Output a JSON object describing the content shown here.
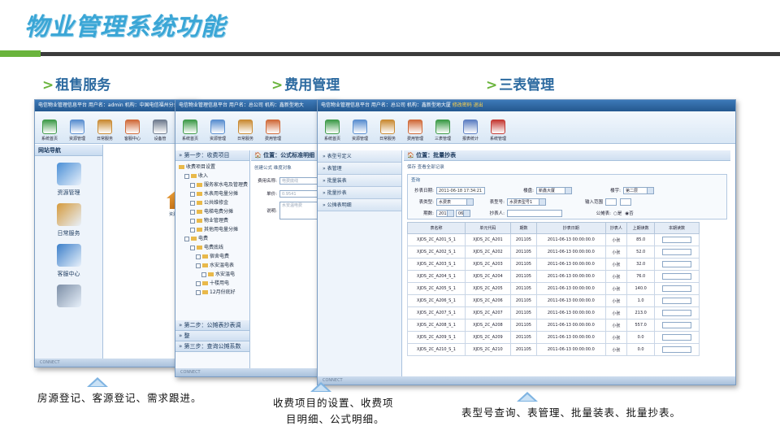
{
  "slide": {
    "title": "物业管理系统功能",
    "sections": [
      {
        "heading": "租售服务",
        "caption": "房源登记、客源登记、需求跟进。"
      },
      {
        "heading": "费用管理",
        "caption_line1": "收费项目的设置、收费项",
        "caption_line2": "目明细、公式明细。"
      },
      {
        "heading": "三表管理",
        "caption": "表型号查询、表管理、批量装表、批量抄表。"
      }
    ],
    "arrow_prefix": ">"
  },
  "screen1": {
    "topbar": "电信物业管理信息平台  用户名：admin  机构：中国电信福州分公",
    "toolbar": [
      {
        "label": "系统首页",
        "icon": "home-icon",
        "color": "#3f9b4a"
      },
      {
        "label": "资源管理",
        "icon": "resource-icon",
        "color": "#5a8fd0"
      },
      {
        "label": "日常服务",
        "icon": "service-icon",
        "color": "#c98b34"
      },
      {
        "label": "客服中心",
        "icon": "customer-icon",
        "color": "#d06a3a"
      },
      {
        "label": "设备管",
        "icon": "device-icon",
        "color": "#6f7c8f"
      }
    ],
    "nav_head": "网站导航",
    "nav_items": [
      {
        "label": "资源管理",
        "icon": "resource-folder-icon",
        "color": "#4a8fd6"
      },
      {
        "label": "日常服务",
        "icon": "daily-service-icon",
        "color": "#d59a3c"
      },
      {
        "label": "客服中心",
        "icon": "customer-center-icon",
        "color": "#3b7fc9"
      },
      {
        "label": "",
        "icon": "server-icon",
        "color": "#7c8ea6"
      }
    ],
    "side_item": "资源管理",
    "footer": "CONNECT"
  },
  "screen2": {
    "topbar": "电信物业管理信息平台  用户名：总公司  机构：鑫新型地大",
    "toolbar": [
      {
        "label": "系统首页",
        "icon": "home-icon",
        "color": "#3f9b4a"
      },
      {
        "label": "资源管理",
        "icon": "resource-icon",
        "color": "#5a8fd0"
      },
      {
        "label": "日常服务",
        "icon": "service-icon",
        "color": "#c98b34"
      },
      {
        "label": "费用管理",
        "icon": "fee-icon",
        "color": "#d06a3a"
      }
    ],
    "step1": "第一步：收费项目",
    "step2": "第二步：公摊表抄表调",
    "step2b": "整",
    "step3": "第三步：查询公摊系数",
    "tree": [
      {
        "indent": 0,
        "text": "收费项目设置"
      },
      {
        "indent": 1,
        "text": "收入"
      },
      {
        "indent": 2,
        "text": "服务家水电及管理费"
      },
      {
        "indent": 2,
        "text": "水表用电量分摊"
      },
      {
        "indent": 2,
        "text": "公共维修金"
      },
      {
        "indent": 2,
        "text": "电梯电费分摊"
      },
      {
        "indent": 2,
        "text": "物业管理费"
      },
      {
        "indent": 2,
        "text": "其他用电量分摊"
      },
      {
        "indent": 1,
        "text": "电费"
      },
      {
        "indent": 2,
        "text": "电费底线"
      },
      {
        "indent": 3,
        "text": "宿舍电费"
      },
      {
        "indent": 3,
        "text": "水安温电表"
      },
      {
        "indent": 4,
        "text": "水安温电"
      },
      {
        "indent": 3,
        "text": "十楼用电"
      },
      {
        "indent": 3,
        "text": "12月份底好"
      }
    ],
    "pos": "位置：公式标准明细",
    "subbar": "创建公式  维度对象",
    "form": [
      {
        "label": "费用名称:",
        "value": "电费底线"
      },
      {
        "label": "单价:",
        "value": "0.9541"
      },
      {
        "label": "说明:",
        "value": "水安温电费"
      }
    ],
    "footer": "CONNECT"
  },
  "screen3": {
    "topbar_prefix": "电信物业管理信息平台  用户名：总公司  机构：鑫新型地大厦",
    "topbar_highlight": "修改密码  退出",
    "toolbar": [
      {
        "label": "系统首页",
        "icon": "home-icon",
        "color": "#3f9b4a"
      },
      {
        "label": "资源管理",
        "icon": "resource-icon",
        "color": "#5a8fd0"
      },
      {
        "label": "日常服务",
        "icon": "service-icon",
        "color": "#c98b34"
      },
      {
        "label": "费用管理",
        "icon": "fee-icon",
        "color": "#d06a3a"
      },
      {
        "label": "三表管理",
        "icon": "meter-icon",
        "color": "#3c9b47"
      },
      {
        "label": "报表统计",
        "icon": "report-icon",
        "color": "#5d7fc2"
      },
      {
        "label": "系统管理",
        "icon": "system-icon",
        "color": "#c43a34"
      }
    ],
    "menu": [
      "表型号定义",
      "表管理",
      "批量装表",
      "批量抄表",
      "公摊表明细"
    ],
    "pos": "位置：批量抄表",
    "actions": "保存  查看全部记录",
    "query_tab": "查询",
    "form": {
      "reading_date_label": "抄表日期:",
      "reading_date_value": "2011-06-18 17:34:21",
      "building_label": "楼盘:",
      "building_value": "新鑫大厦",
      "floor_label": "楼宇:",
      "floor_value": "第二层",
      "meter_type_label": "表类型:",
      "meter_type_value": "水费表",
      "meter_no_label": "表型号:",
      "meter_no_value": "水费表型号1",
      "input_range_label": "输入范围",
      "period_label": "期数:",
      "period_year": "2011",
      "period_month": "06",
      "reader_label": "抄表人:",
      "shared_label": "公摊表:",
      "shared_yes": "是",
      "shared_no": "否"
    },
    "columns": [
      "表名称",
      "单元代码",
      "期数",
      "抄表日期",
      "抄表人",
      "上期读数",
      "本期读数"
    ],
    "rows": [
      [
        "XJDS_2C_A201_S_1",
        "XJDS_2C_A201",
        "201105",
        "2011-06-13 00:00:00.0",
        "小张",
        "85.0"
      ],
      [
        "XJDS_2C_A202_S_1",
        "XJDS_2C_A202",
        "201105",
        "2011-06-13 00:00:00.0",
        "小张",
        "52.0"
      ],
      [
        "XJDS_2C_A203_S_1",
        "XJDS_2C_A203",
        "201105",
        "2011-06-13 00:00:00.0",
        "小张",
        "32.0"
      ],
      [
        "XJDS_2C_A204_S_1",
        "XJDS_2C_A204",
        "201105",
        "2011-06-13 00:00:00.0",
        "小张",
        "76.0"
      ],
      [
        "XJDS_2C_A205_S_1",
        "XJDS_2C_A205",
        "201105",
        "2011-06-13 00:00:00.0",
        "小张",
        "140.0"
      ],
      [
        "XJDS_2C_A206_S_1",
        "XJDS_2C_A206",
        "201105",
        "2011-06-13 00:00:00.0",
        "小张",
        "1.0"
      ],
      [
        "XJDS_2C_A207_S_1",
        "XJDS_2C_A207",
        "201105",
        "2011-06-13 00:00:00.0",
        "小张",
        "213.0"
      ],
      [
        "XJDS_2C_A208_S_1",
        "XJDS_2C_A208",
        "201105",
        "2011-06-13 00:00:00.0",
        "小张",
        "557.0"
      ],
      [
        "XJDS_2C_A209_S_1",
        "XJDS_2C_A209",
        "201105",
        "2011-06-13 00:00:00.0",
        "小张",
        "0.0"
      ],
      [
        "XJDS_2C_A210_S_1",
        "XJDS_2C_A210",
        "201105",
        "2011-06-13 00:00:00.0",
        "小张",
        "0.0"
      ]
    ],
    "footer": "CONNECT"
  },
  "colors": {
    "title": "#3aa6d6",
    "accent_green": "#6ab43c",
    "heading_blue": "#2c6aa0",
    "ui_blue": "#3d79b8"
  }
}
